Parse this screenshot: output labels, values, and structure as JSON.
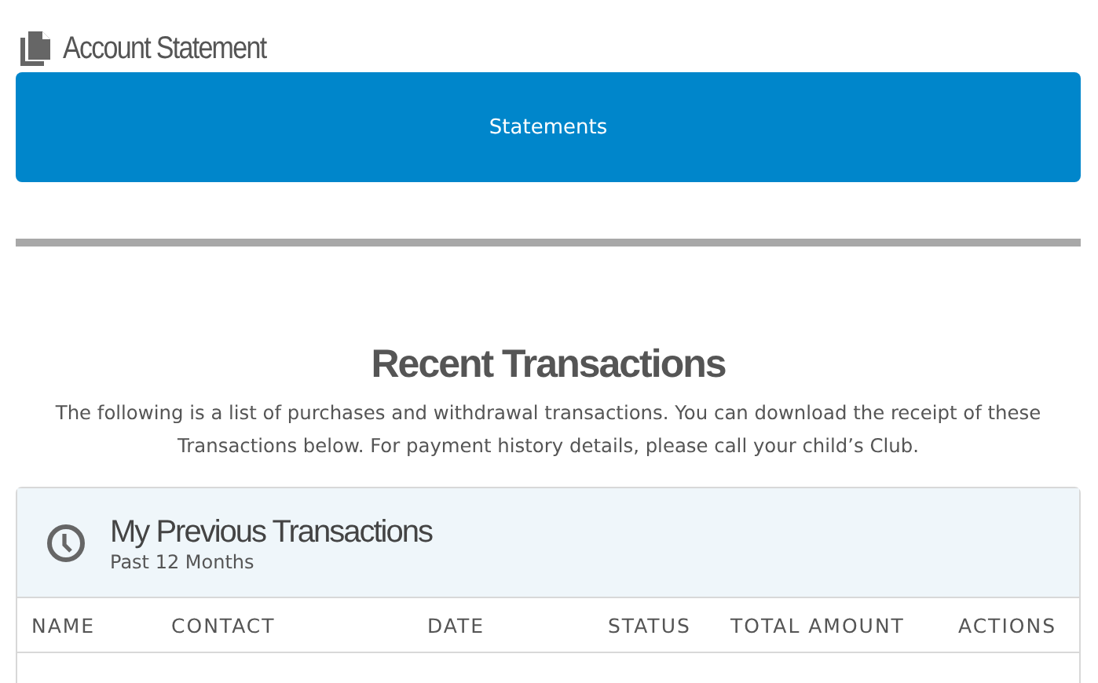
{
  "header": {
    "title": "Account Statement"
  },
  "statements_button": {
    "label": "Statements"
  },
  "recent": {
    "title": "Recent Transactions",
    "description": "The following is a list of purchases and withdrawal transactions. You can download the receipt of these Transactions below. For payment history details, please call your child’s Club."
  },
  "card": {
    "title": "My Previous Transactions",
    "subtitle": "Past 12 Months"
  },
  "table": {
    "columns": [
      "NAME",
      "CONTACT",
      "DATE",
      "STATUS",
      "TOTAL AMOUNT",
      "ACTIONS"
    ]
  }
}
